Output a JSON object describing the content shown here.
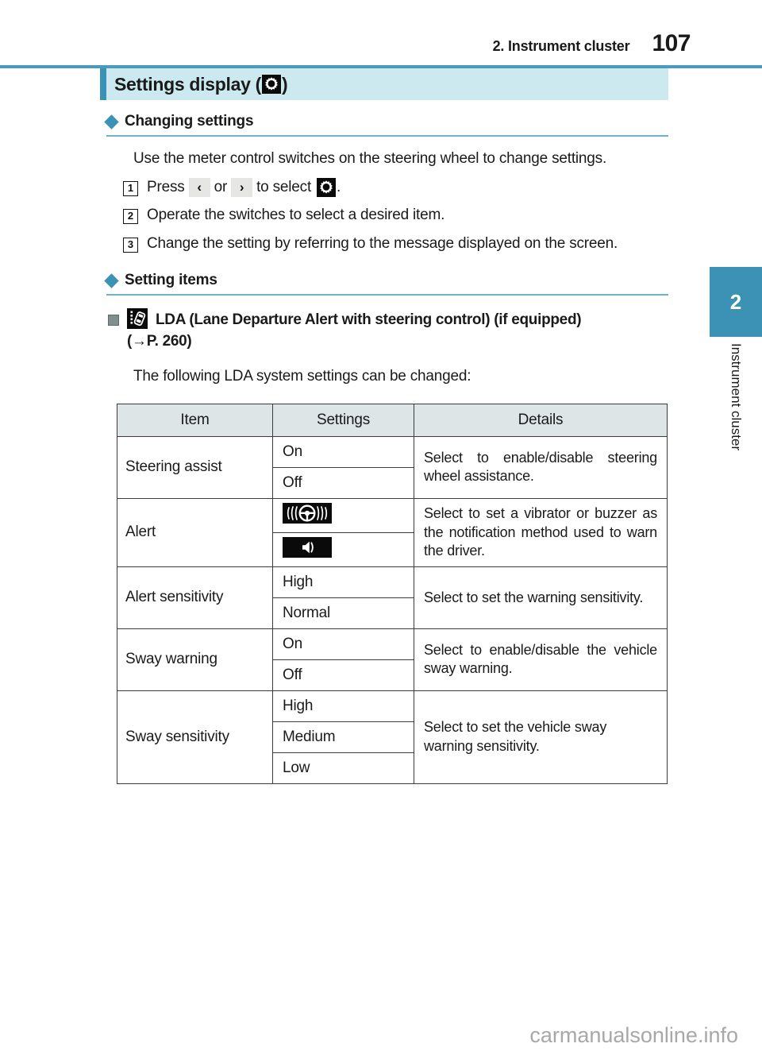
{
  "header": {
    "section_title": "2. Instrument cluster",
    "page_number": "107",
    "rule_color": "#4a9cba"
  },
  "chapter_tab": {
    "number": "2",
    "label": "Instrument cluster",
    "color": "#3b92b4"
  },
  "title_band": {
    "text_before": "Settings display (",
    "icon": "gear-icon",
    "text_after": ")",
    "band_color": "#cbe9ee",
    "accent_color": "#3b92b4"
  },
  "sections": {
    "changing_settings": {
      "heading": "Changing settings",
      "intro": "Use the meter control switches on the steering wheel to change settings.",
      "steps": [
        {
          "number": "1",
          "text_before": "Press",
          "key_left": "‹",
          "conjunction": "or",
          "key_right": "›",
          "text_middle": "to select",
          "icon": "gear-icon",
          "text_after": "."
        },
        {
          "number": "2",
          "text": "Operate the switches to select a desired item."
        },
        {
          "number": "3",
          "text": "Change the setting by referring to the message displayed on the screen."
        }
      ]
    },
    "setting_items": {
      "heading": "Setting items",
      "item_icon": "lda-icon",
      "item_title": "LDA (Lane Departure Alert with steering control) (if equipped)",
      "item_reference": "(→P. 260)",
      "item_intro": "The following LDA system settings can be changed:"
    }
  },
  "table": {
    "headers": [
      "Item",
      "Settings",
      "Details"
    ],
    "rows": [
      {
        "item": "Steering assist",
        "settings": [
          {
            "type": "text",
            "value": "On"
          },
          {
            "type": "text",
            "value": "Off"
          }
        ],
        "details": "Select to enable/disable steering wheel assistance."
      },
      {
        "item": "Alert",
        "settings": [
          {
            "type": "icon",
            "value": "steering-wheel-vibration-icon"
          },
          {
            "type": "icon",
            "value": "speaker-buzzer-icon"
          }
        ],
        "details": "Select to set a vibrator or buzzer as the notification method used to warn the driver."
      },
      {
        "item": "Alert sensitivity",
        "settings": [
          {
            "type": "text",
            "value": "High"
          },
          {
            "type": "text",
            "value": "Normal"
          }
        ],
        "details": "Select to set the warning sensitivity."
      },
      {
        "item": "Sway warning",
        "settings": [
          {
            "type": "text",
            "value": "On"
          },
          {
            "type": "text",
            "value": "Off"
          }
        ],
        "details": "Select to enable/disable the vehicle sway warning."
      },
      {
        "item": "Sway sensitivity",
        "settings": [
          {
            "type": "text",
            "value": "High"
          },
          {
            "type": "text",
            "value": "Medium"
          },
          {
            "type": "text",
            "value": "Low"
          }
        ],
        "details": "Select to set the vehicle sway warning sensitivity."
      }
    ]
  },
  "footer": {
    "watermark": "carmanualsonline.info"
  }
}
